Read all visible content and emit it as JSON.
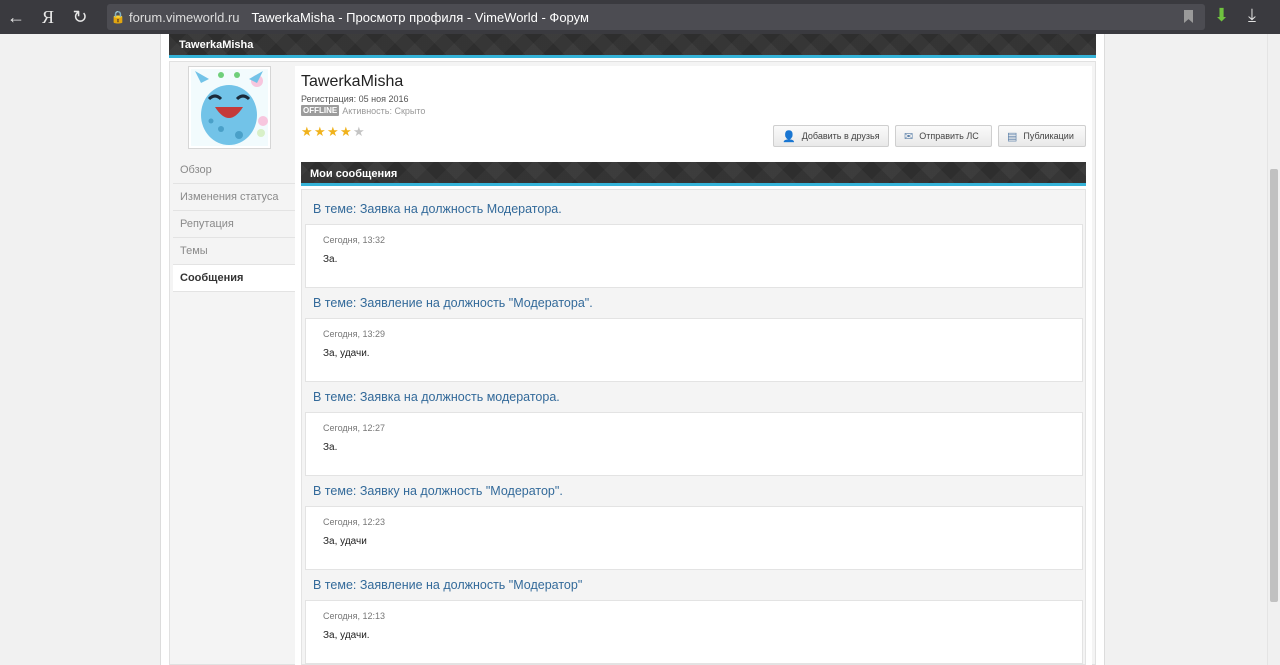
{
  "browser": {
    "back_icon": "arrow-left-icon",
    "yandex_label": "Я",
    "reload_icon": "reload-icon",
    "domain": "forum.vimeworld.ru",
    "page_title": "TawerkaMisha - Просмотр профиля - VimeWorld - Форум"
  },
  "header": {
    "title": "TawerkaMisha"
  },
  "profile": {
    "name": "TawerkaMisha",
    "registration": "Регистрация: 05 ноя 2016",
    "status_badge": "OFFLINE",
    "activity": "Активность: Скрыто",
    "rating_stars": 4,
    "rating_max": 5
  },
  "actions": {
    "add_friend": "Добавить в друзья",
    "send_pm": "Отправить ЛС",
    "publications": "Публикации"
  },
  "sidebar": {
    "items": [
      {
        "label": "Обзор"
      },
      {
        "label": "Изменения статуса"
      },
      {
        "label": "Репутация"
      },
      {
        "label": "Темы"
      },
      {
        "label": "Сообщения"
      }
    ]
  },
  "posts": {
    "header": "Мои сообщения",
    "items": [
      {
        "title": "В теме: Заявка на должность Модератора.",
        "date": "Сегодня, 13:32",
        "text": "За."
      },
      {
        "title": "В теме: Заявление на должность \"Модератора\".",
        "date": "Сегодня, 13:29",
        "text": "За, удачи."
      },
      {
        "title": "В теме: Заявка на должность модератора.",
        "date": "Сегодня, 12:27",
        "text": "За."
      },
      {
        "title": "В теме: Заявку на должность \"Модератор\".",
        "date": "Сегодня, 12:23",
        "text": "За, удачи"
      },
      {
        "title": "В теме: Заявление на должность \"Модератор\"",
        "date": "Сегодня, 12:13",
        "text": "За, удачи."
      }
    ]
  },
  "colors": {
    "accent": "#35b3d8",
    "link": "#336a9a",
    "header_bg": "#2e2e2e",
    "star": "#f0b21c"
  }
}
